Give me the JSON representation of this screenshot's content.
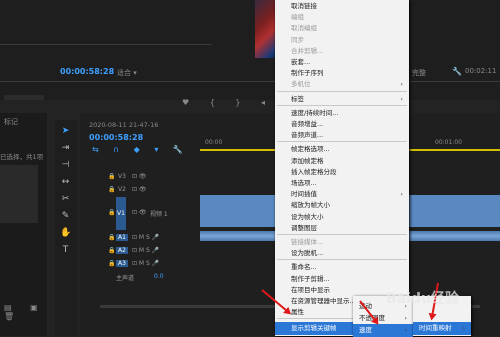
{
  "source_panel": {
    "timecode": "00:00:58:28",
    "fit_label": "适合",
    "tab_label": "标记",
    "selected_info": "已选择，共1项"
  },
  "program_panel": {
    "timecode_right": "00:02:11",
    "quality_label": "完整"
  },
  "timeline": {
    "sequence_name": "2020-08-11 21-47-16",
    "timecode": "00:00:58:28",
    "ruler_start": "00:00",
    "ruler_end": "00:01:00",
    "tracks": [
      {
        "name": "V3",
        "label": ""
      },
      {
        "name": "V2",
        "label": ""
      },
      {
        "name": "V1",
        "label": "视频 1"
      },
      {
        "name": "A1",
        "label": ""
      },
      {
        "name": "A2",
        "label": ""
      },
      {
        "name": "A3",
        "label": ""
      }
    ],
    "master_label": "主声道",
    "master_value": "0.0"
  },
  "context_menu": {
    "items": [
      {
        "label": "取消链接",
        "enabled": true,
        "submenu": false
      },
      {
        "label": "编组",
        "enabled": false,
        "submenu": false
      },
      {
        "label": "取消编组",
        "enabled": false,
        "submenu": false
      },
      {
        "label": "同步",
        "enabled": false,
        "submenu": false
      },
      {
        "label": "合并剪辑...",
        "enabled": false,
        "submenu": false
      },
      {
        "label": "嵌套...",
        "enabled": true,
        "submenu": false
      },
      {
        "label": "制作子序列",
        "enabled": true,
        "submenu": false
      },
      {
        "label": "多机位",
        "enabled": false,
        "submenu": true
      },
      {
        "label": "标签",
        "enabled": true,
        "submenu": true
      },
      {
        "label": "速度/持续时间...",
        "enabled": true,
        "submenu": false
      },
      {
        "label": "音频增益...",
        "enabled": true,
        "submenu": false
      },
      {
        "label": "音频声道...",
        "enabled": true,
        "submenu": false
      },
      {
        "label": "帧定格选项...",
        "enabled": true,
        "submenu": false
      },
      {
        "label": "添加帧定格",
        "enabled": true,
        "submenu": false
      },
      {
        "label": "插入帧定格分段",
        "enabled": true,
        "submenu": false
      },
      {
        "label": "场选项...",
        "enabled": true,
        "submenu": false
      },
      {
        "label": "时间插值",
        "enabled": true,
        "submenu": true
      },
      {
        "label": "缩放为帧大小",
        "enabled": true,
        "submenu": false
      },
      {
        "label": "设为帧大小",
        "enabled": true,
        "submenu": false
      },
      {
        "label": "调整图层",
        "enabled": true,
        "submenu": false
      },
      {
        "label": "链接媒体...",
        "enabled": false,
        "submenu": false
      },
      {
        "label": "设为脱机...",
        "enabled": true,
        "submenu": false
      },
      {
        "label": "重命名...",
        "enabled": true,
        "submenu": false
      },
      {
        "label": "制作子剪辑...",
        "enabled": true,
        "submenu": false
      },
      {
        "label": "在项目中显示",
        "enabled": true,
        "submenu": false
      },
      {
        "label": "在资源管理器中显示...",
        "enabled": true,
        "submenu": false
      },
      {
        "label": "属性",
        "enabled": true,
        "submenu": false
      },
      {
        "label": "显示剪辑关键帧",
        "enabled": true,
        "submenu": true
      }
    ]
  },
  "submenu1": {
    "items": [
      {
        "label": "运动",
        "submenu": true
      },
      {
        "label": "不透明度",
        "submenu": true
      },
      {
        "label": "速度",
        "submenu": true
      }
    ]
  },
  "submenu2": {
    "items": [
      {
        "label": "时间重映射",
        "submenu": true
      }
    ]
  },
  "watermark": "Baidu经验",
  "colors": {
    "accent": "#2b77d6",
    "timecode": "#3ea0ff",
    "arrow": "#e01818",
    "clip": "#5a88c0"
  }
}
